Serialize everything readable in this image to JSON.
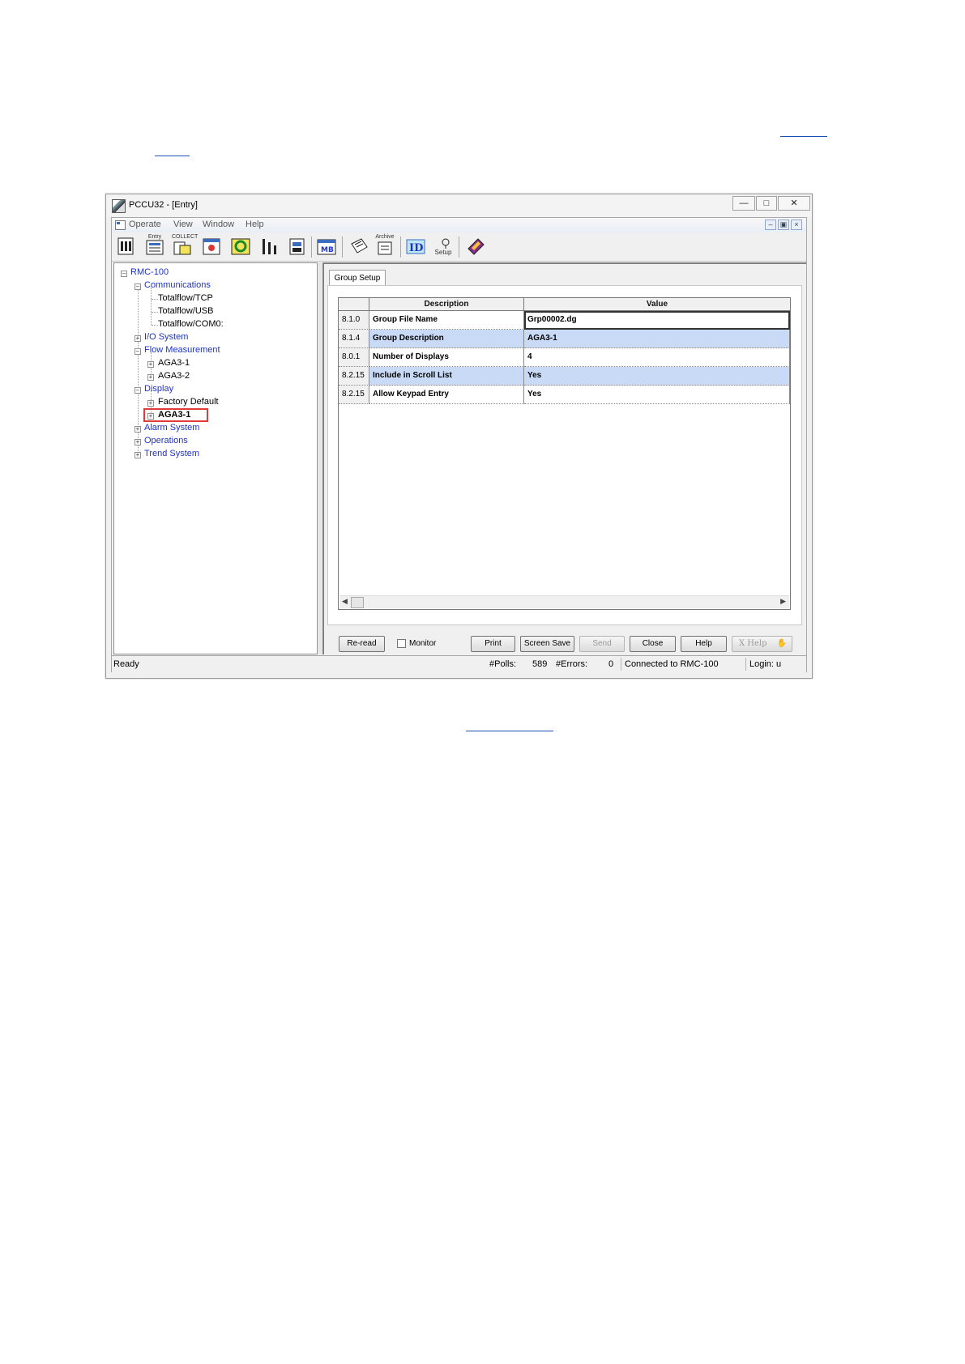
{
  "window": {
    "title": "PCCU32 - [Entry]"
  },
  "menubar": {
    "items": [
      "Operate",
      "View",
      "Window",
      "Help"
    ]
  },
  "toolbar": {
    "buttons": [
      {
        "name": "terminal-icon",
        "caption": ""
      },
      {
        "name": "entry-icon",
        "caption": "Entry"
      },
      {
        "name": "collect-icon",
        "caption": "COLLECT"
      },
      {
        "name": "report-icon",
        "caption": ""
      },
      {
        "name": "sync-icon",
        "caption": ""
      },
      {
        "name": "calibrate-icon",
        "caption": ""
      },
      {
        "name": "loader-icon",
        "caption": ""
      },
      {
        "name": "modbus-icon",
        "caption": ""
      },
      {
        "name": "notes-icon",
        "caption": ""
      },
      {
        "name": "archive-icon",
        "caption": "Archive"
      },
      {
        "name": "id-manager-icon",
        "caption": ""
      },
      {
        "name": "setup-icon",
        "caption": "Setup"
      },
      {
        "name": "help-book-icon",
        "caption": ""
      }
    ]
  },
  "tree": {
    "root": "RMC-100",
    "communications": "Communications",
    "comm_children": [
      "Totalflow/TCP",
      "Totalflow/USB",
      "Totalflow/COM0:"
    ],
    "io_system": "I/O System",
    "flow_measurement": "Flow Measurement",
    "flow_children": [
      "AGA3-1",
      "AGA3-2"
    ],
    "display": "Display",
    "display_children": [
      "Factory Default",
      "AGA3-1"
    ],
    "alarm_system": "Alarm System",
    "operations": "Operations",
    "trend_system": "Trend System"
  },
  "tab": {
    "label": "Group Setup"
  },
  "grid": {
    "headers": [
      "Description",
      "Value"
    ],
    "rows": [
      {
        "id": "8.1.0",
        "description": "Group File Name",
        "value": "Grp00002.dg",
        "selected": false
      },
      {
        "id": "8.1.4",
        "description": "Group Description",
        "value": "AGA3-1",
        "selected": true
      },
      {
        "id": "8.0.1",
        "description": "Number of Displays",
        "value": "4",
        "selected": false
      },
      {
        "id": "8.2.15",
        "description": "Include in Scroll List",
        "value": "Yes",
        "selected": true
      },
      {
        "id": "8.2.15",
        "description": "Allow Keypad Entry",
        "value": "Yes",
        "selected": false
      }
    ]
  },
  "buttons": {
    "reread": "Re-read",
    "monitor": "Monitor",
    "print": "Print",
    "screen_save": "Screen Save",
    "send": "Send",
    "close": "Close",
    "help": "Help",
    "xhelp": "X Help"
  },
  "status": {
    "state": "Ready",
    "polls_label": "#Polls:",
    "polls_value": "589",
    "errors_label": "#Errors:",
    "errors_value": "0",
    "connection": "Connected to RMC-100",
    "login": "Login: u"
  },
  "colors": {
    "selection": "#c8daf6",
    "tree_link": "#1d33c8",
    "highlight_box": "#e03a3a"
  }
}
